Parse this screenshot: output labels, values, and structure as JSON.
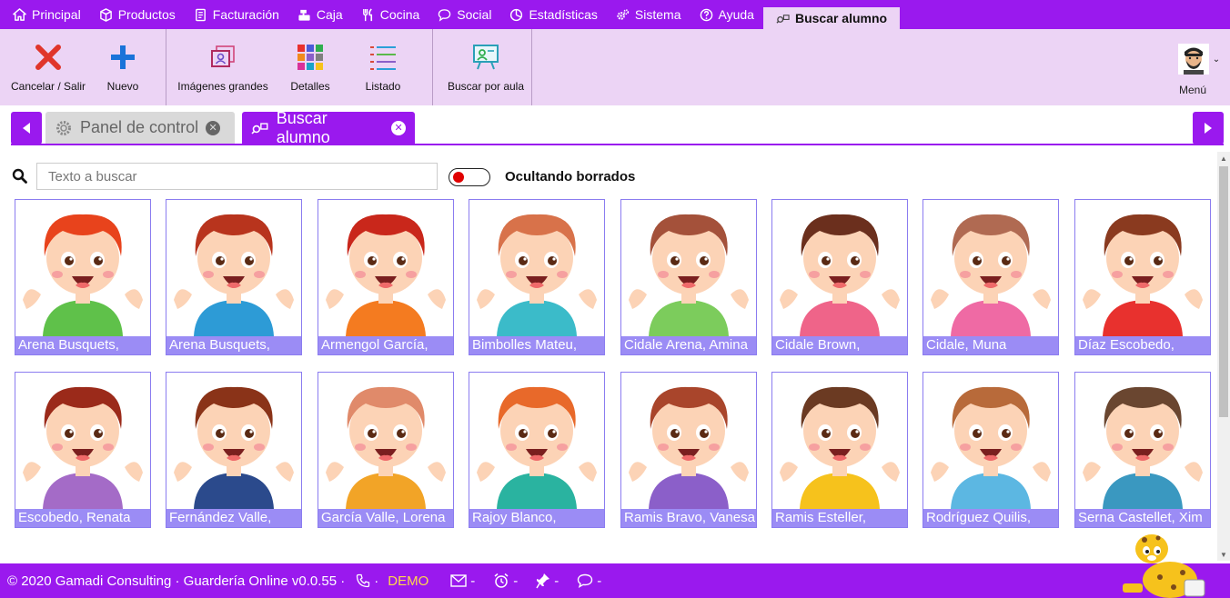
{
  "menubar": {
    "items": [
      {
        "label": "Principal",
        "icon": "home-icon"
      },
      {
        "label": "Productos",
        "icon": "cube-icon"
      },
      {
        "label": "Facturación",
        "icon": "document-icon"
      },
      {
        "label": "Caja",
        "icon": "cash-register-icon"
      },
      {
        "label": "Cocina",
        "icon": "utensils-icon"
      },
      {
        "label": "Social",
        "icon": "chat-icon"
      },
      {
        "label": "Estadísticas",
        "icon": "pie-chart-icon"
      },
      {
        "label": "Sistema",
        "icon": "gears-icon"
      },
      {
        "label": "Ayuda",
        "icon": "question-icon"
      },
      {
        "label": "Buscar alumno",
        "icon": "search-student-icon",
        "active": true
      }
    ]
  },
  "ribbon": {
    "cancel": "Cancelar / Salir",
    "new": "Nuevo",
    "big_images": "Imágenes grandes",
    "details": "Detalles",
    "list": "Listado",
    "by_class": "Buscar por aula",
    "menu": "Menú"
  },
  "tabs": {
    "control_panel": "Panel de control",
    "search_student": "Buscar alumno"
  },
  "search": {
    "placeholder": "Texto a buscar",
    "toggle_label": "Ocultando borrados"
  },
  "students": [
    {
      "name": "Arena Busquets,",
      "hair": "#e8431c",
      "shirt": "#5fc14a",
      "skin": "#fcd3b6"
    },
    {
      "name": "Arena Busquets,",
      "hair": "#b8341d",
      "shirt": "#2d9bd6",
      "skin": "#fcd3b6"
    },
    {
      "name": "Armengol García,",
      "hair": "#c9271b",
      "shirt": "#f47b20",
      "skin": "#fcd3b6"
    },
    {
      "name": "Bimbolles Mateu,",
      "hair": "#d8724a",
      "shirt": "#3bbbc9",
      "skin": "#fcd3b6"
    },
    {
      "name": "Cidale Arena, Amina",
      "hair": "#a4513a",
      "shirt": "#7ccc5c",
      "skin": "#fcd3b6"
    },
    {
      "name": "Cidale Brown,",
      "hair": "#6b2f1d",
      "shirt": "#ef6489",
      "skin": "#fcd3b6"
    },
    {
      "name": "Cidale, Muna",
      "hair": "#b06a52",
      "shirt": "#ef6aa4",
      "skin": "#fcd3b6"
    },
    {
      "name": "Díaz Escobedo,",
      "hair": "#8a3a1f",
      "shirt": "#e8312e",
      "skin": "#fcd3b6"
    },
    {
      "name": "Escobedo, Renata",
      "hair": "#9b2a1a",
      "shirt": "#a46bc7",
      "skin": "#fcd3b6"
    },
    {
      "name": "Fernández Valle,",
      "hair": "#8a3318",
      "shirt": "#2b4a8c",
      "skin": "#fcd3b6"
    },
    {
      "name": "García Valle, Lorena",
      "hair": "#e08a6a",
      "shirt": "#f2a427",
      "skin": "#fcd3b6"
    },
    {
      "name": "Rajoy Blanco,",
      "hair": "#e8692a",
      "shirt": "#2ab3a0",
      "skin": "#fcd3b6"
    },
    {
      "name": "Ramis Bravo, Vanesa",
      "hair": "#a9452b",
      "shirt": "#8b5fc9",
      "skin": "#fcd3b6"
    },
    {
      "name": "Ramis Esteller,",
      "hair": "#6b3a22",
      "shirt": "#f6c21c",
      "skin": "#fcd3b6"
    },
    {
      "name": "Rodríguez Quilis,",
      "hair": "#b86a3a",
      "shirt": "#5cb7e2",
      "skin": "#fcd3b6"
    },
    {
      "name": "Serna Castellet, Xim",
      "hair": "#6a4630",
      "shirt": "#3a98c0",
      "skin": "#fcd3b6"
    }
  ],
  "footer": {
    "copyright": "© 2020 Gamadi Consulting · Guardería Online v0.0.55 ·",
    "demo": "DEMO",
    "dash1": "-",
    "dash2": "-",
    "dash3": "-",
    "dash4": "-"
  },
  "colors": {
    "accent": "#9a19ee",
    "ribbon_bg": "#ecd4f5",
    "card_label_bg": "#9b8cf5",
    "toggle_knob": "#e00000",
    "demo_text": "#ffd84a"
  }
}
